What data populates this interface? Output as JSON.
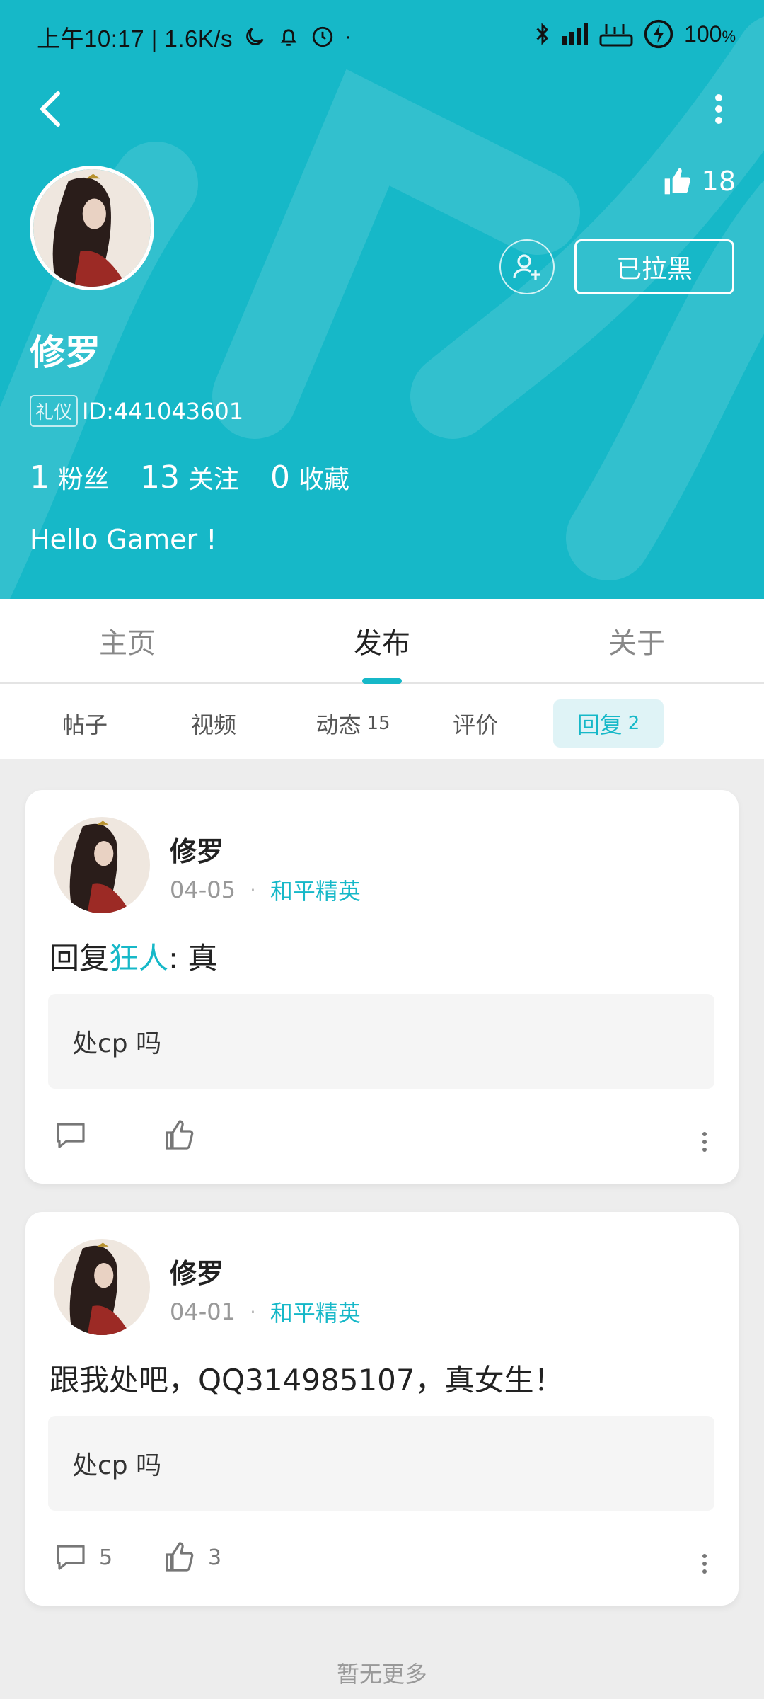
{
  "status_bar": {
    "time_speed": "上午10:17 | 1.6K/s",
    "battery": "100"
  },
  "profile": {
    "likes": "18",
    "blocked_label": "已拉黑",
    "name": "修罗",
    "tag": "礼仪",
    "id_text": "ID:441043601",
    "stats": [
      {
        "num": "1",
        "label": "粉丝"
      },
      {
        "num": "13",
        "label": "关注"
      },
      {
        "num": "0",
        "label": "收藏"
      }
    ],
    "bio": "Hello Gamer !"
  },
  "tabs": [
    "主页",
    "发布",
    "关于"
  ],
  "active_tab": "发布",
  "sub_tabs": [
    {
      "label": "帖子",
      "count": ""
    },
    {
      "label": "视频",
      "count": ""
    },
    {
      "label": "动态",
      "count": "15"
    },
    {
      "label": "评价",
      "count": ""
    },
    {
      "label": "回复",
      "count": "2"
    }
  ],
  "posts": [
    {
      "name": "修罗",
      "date": "04-05",
      "game": "和平精英",
      "text_prefix": "回复",
      "text_highlight": "狂人",
      "text_suffix": ": 真",
      "quote": "处cp 吗",
      "comments": "",
      "likes": ""
    },
    {
      "name": "修罗",
      "date": "04-01",
      "game": "和平精英",
      "text_prefix": "跟我处吧，QQ314985107，真女生！",
      "text_highlight": "",
      "text_suffix": "",
      "quote": "处cp 吗",
      "comments": "5",
      "likes": "3"
    }
  ],
  "footer": "暂无更多",
  "colors": {
    "accent": "#16b8c8",
    "header_bg": "#16b8c8"
  }
}
